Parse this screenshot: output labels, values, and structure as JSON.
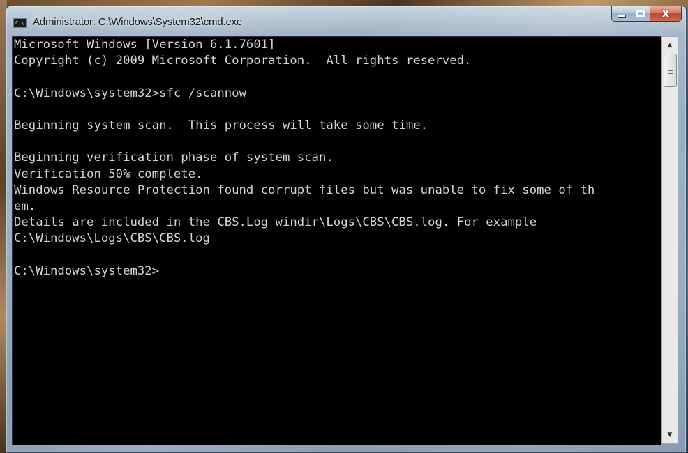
{
  "window": {
    "title": "Administrator: C:\\Windows\\System32\\cmd.exe",
    "app_icon_text": "C:\\",
    "icon": "cmd-icon"
  },
  "caption_buttons": {
    "minimize_icon": "minimize-icon",
    "maximize_icon": "maximize-icon",
    "close_icon": "close-icon",
    "close_glyph": "X"
  },
  "console": {
    "lines": [
      "Microsoft Windows [Version 6.1.7601]",
      "Copyright (c) 2009 Microsoft Corporation.  All rights reserved.",
      "",
      "C:\\Windows\\system32>sfc /scannow",
      "",
      "Beginning system scan.  This process will take some time.",
      "",
      "Beginning verification phase of system scan.",
      "Verification 50% complete.",
      "Windows Resource Protection found corrupt files but was unable to fix some of th",
      "em.",
      "Details are included in the CBS.Log windir\\Logs\\CBS\\CBS.log. For example",
      "C:\\Windows\\Logs\\CBS\\CBS.log",
      "",
      "C:\\Windows\\system32>"
    ]
  },
  "scrollbar": {
    "up_arrow": "▲",
    "down_arrow": "▼"
  }
}
